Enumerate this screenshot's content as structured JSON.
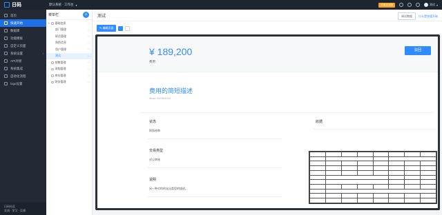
{
  "topbar": {
    "logo": "日码",
    "workspace": "默认系统 · 工作台",
    "upgrade": "升级企业版",
    "user": "测试"
  },
  "sidebar": {
    "items": [
      {
        "label": "首页"
      },
      {
        "label": "快速开始"
      },
      {
        "label": "数据库"
      },
      {
        "label": "功能模板"
      },
      {
        "label": "自定义页面"
      },
      {
        "label": "系统设置"
      },
      {
        "label": "API对接"
      },
      {
        "label": "系统集成"
      },
      {
        "label": "自动化流程"
      },
      {
        "label": "logo设置"
      }
    ],
    "footer": [
      "日码社区",
      "交流 · 学习 · 反馈"
    ]
  },
  "tree": {
    "title": "菜单栏",
    "add": "+",
    "rows": [
      {
        "label": "基础信息",
        "kind": "group",
        "open": true
      },
      {
        "label": "部门管理",
        "kind": "child"
      },
      {
        "label": "职员管理",
        "kind": "child"
      },
      {
        "label": "角色信息",
        "kind": "child"
      },
      {
        "label": "用户管理",
        "kind": "child"
      },
      {
        "label": "测试",
        "kind": "child",
        "selected": true
      },
      {
        "label": "销售管理",
        "kind": "group"
      },
      {
        "label": "采购管理",
        "kind": "group"
      },
      {
        "label": "库存管理",
        "kind": "group"
      },
      {
        "label": "财务管理",
        "kind": "group"
      }
    ]
  },
  "main": {
    "title": "测试",
    "restore": "调试数据",
    "help": "什么是快速开始"
  },
  "toolbar": {
    "edit": "编辑页面"
  },
  "preview": {
    "amount": "¥ 189,200",
    "amount_label": "费用",
    "action": "驳回",
    "section_title": "费用的简短描述",
    "section_date": "Mosh 29/05/2020",
    "fields": [
      {
        "label": "状态",
        "value": "财务经审"
      },
      {
        "label": "交易类型",
        "value": "对公转账"
      },
      {
        "label": "说明",
        "value": "另一种对你的支出类型的描述。"
      }
    ],
    "receipt_label": "收据"
  }
}
